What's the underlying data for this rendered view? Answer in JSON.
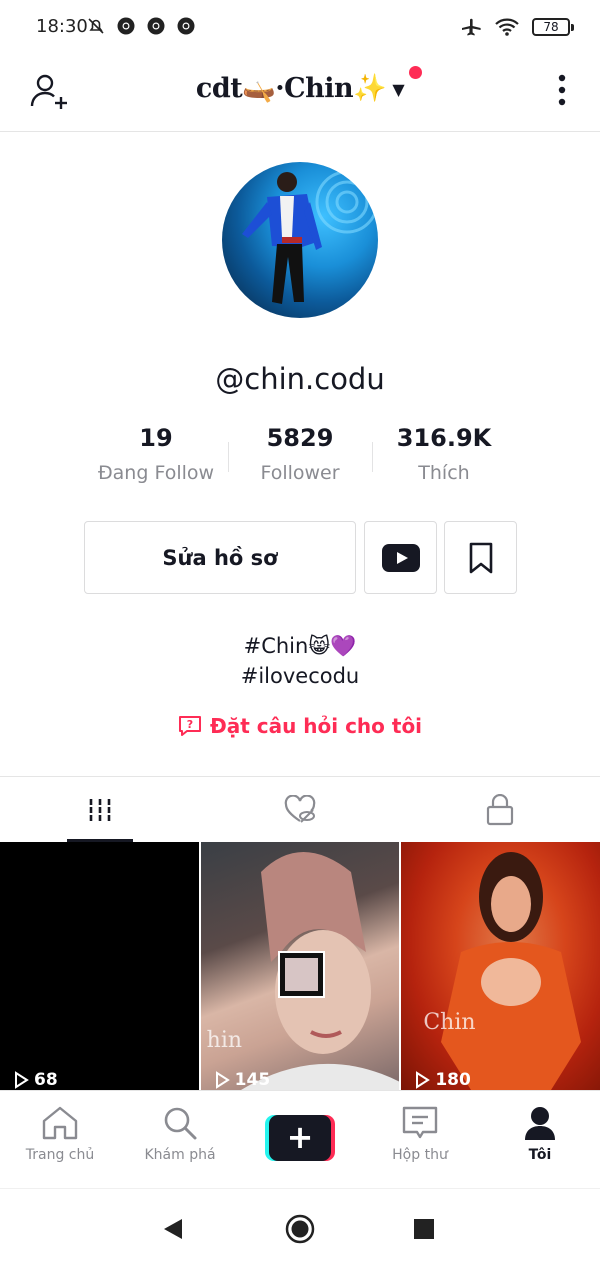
{
  "status_bar": {
    "time": "18:30",
    "battery": "78",
    "left_icons": [
      "mute-bell-icon",
      "chrome-icon",
      "chrome-icon",
      "chrome-icon"
    ],
    "right_icons": [
      "airplane-icon",
      "wifi-icon",
      "battery-icon"
    ]
  },
  "header": {
    "title": "cdt🛶·Chin✨",
    "add_user_icon": "add-user-icon",
    "more_icon": "more-vertical-icon",
    "notification_dot_color": "#fe2c55"
  },
  "profile": {
    "username": "@chin.codu",
    "stats": [
      {
        "value": "19",
        "label": "Đang Follow"
      },
      {
        "value": "5829",
        "label": "Follower"
      },
      {
        "value": "316.9K",
        "label": "Thích"
      }
    ],
    "edit_button": "Sửa hồ sơ",
    "bio_lines": [
      "#Chin😸💜",
      "#ilovecodu"
    ],
    "ask_link": "Đặt câu hỏi cho tôi",
    "accent_color": "#fe2c55"
  },
  "tabs": [
    {
      "icon": "grid-icon",
      "active": true
    },
    {
      "icon": "liked-hidden-icon",
      "active": false
    },
    {
      "icon": "lock-icon",
      "active": false
    }
  ],
  "videos": [
    {
      "views": "68"
    },
    {
      "views": "145",
      "watermark": "hin"
    },
    {
      "views": "180",
      "watermark": "Chin"
    }
  ],
  "bottom_nav": [
    {
      "label": "Trang chủ",
      "icon": "home-icon"
    },
    {
      "label": "Khám phá",
      "icon": "search-icon"
    },
    {
      "label": "",
      "icon": "create-plus-icon"
    },
    {
      "label": "Hộp thư",
      "icon": "inbox-icon"
    },
    {
      "label": "Tôi",
      "icon": "profile-icon",
      "active": true
    }
  ],
  "system_nav": [
    "back-icon",
    "home-circle-icon",
    "recents-icon"
  ]
}
